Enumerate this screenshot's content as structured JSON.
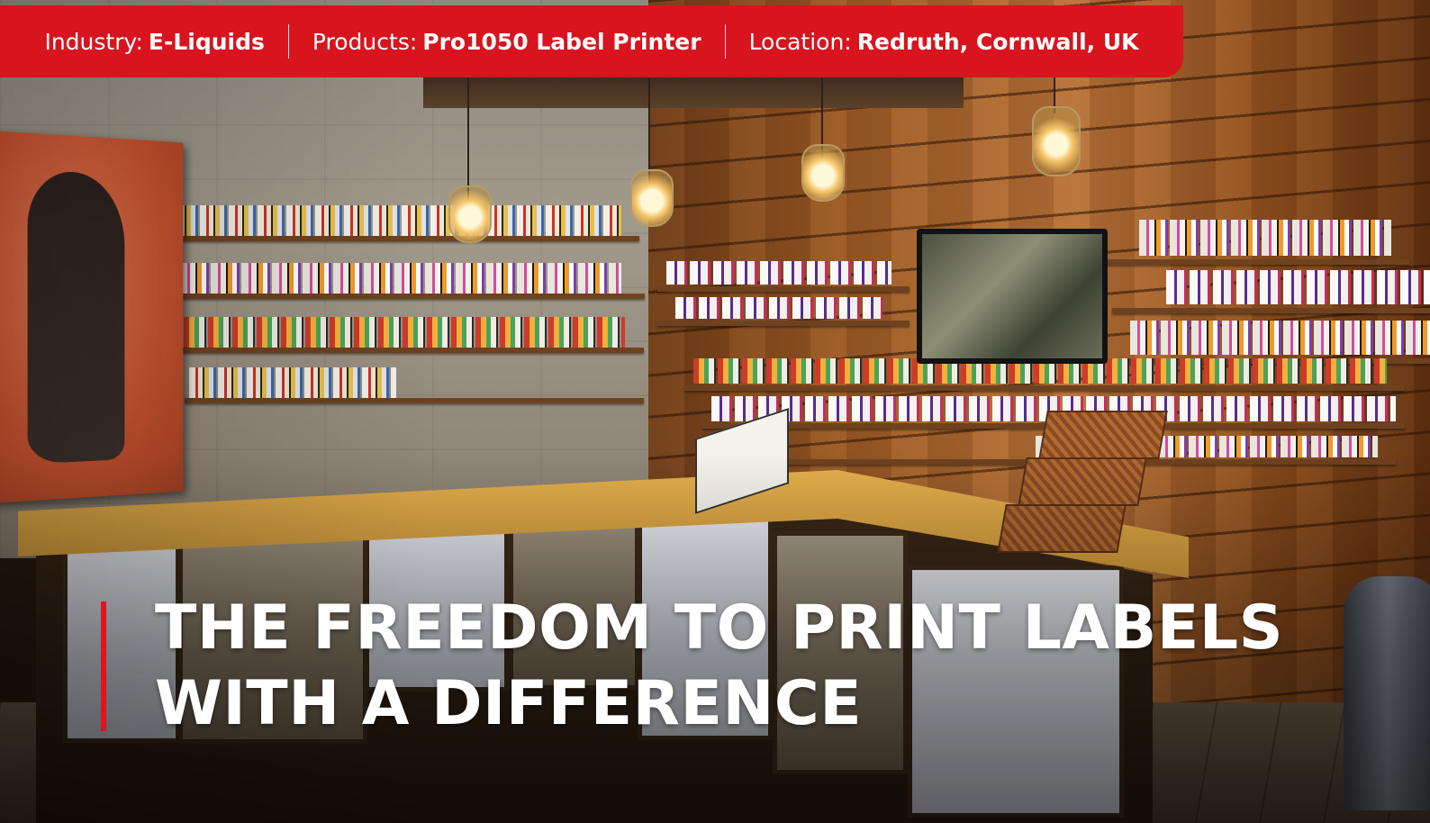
{
  "info_bar": {
    "industry_label": "Industry:",
    "industry_value": "E-Liquids",
    "products_label": "Products:",
    "products_value": "Pro1050 Label Printer",
    "location_label": "Location:",
    "location_value": "Redruth, Cornwall, UK"
  },
  "headline": {
    "line1": "THE FREEDOM TO PRINT LABELS",
    "line2": "WITH A DIFFERENCE"
  },
  "colors": {
    "brand_red": "#d8141f",
    "text": "#ffffff"
  }
}
